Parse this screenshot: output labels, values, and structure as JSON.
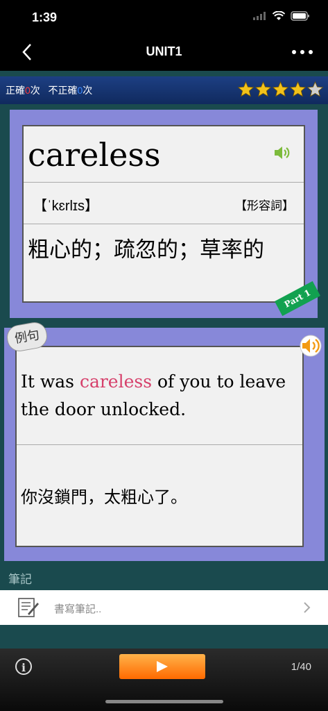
{
  "status_bar": {
    "time": "1:39"
  },
  "nav": {
    "title": "UNIT1"
  },
  "score": {
    "correct_label": "正確",
    "correct_count": "0",
    "times_suffix": "次",
    "incorrect_label": "不正確",
    "incorrect_count": "0",
    "rating": 4,
    "max_rating": 5
  },
  "word_card": {
    "word": "careless",
    "phonetic": "【ˈkɛrlɪs】",
    "part_of_speech": "【形容詞】",
    "meaning": "粗心的；疏忽的；草率的",
    "part_tag": "Part 1"
  },
  "example_card": {
    "badge": "例句",
    "sentence_before": "It was ",
    "sentence_highlight": "careless",
    "sentence_after": " of you to leave the door unlocked.",
    "translation": "你沒鎖門，太粗心了。"
  },
  "notes": {
    "label": "筆記",
    "placeholder": "書寫筆記.."
  },
  "footer": {
    "info": "i",
    "page_indicator": "1/40"
  },
  "colors": {
    "card_border": "#8788d9",
    "highlight": "#d6406b",
    "ribbon": "#12a150",
    "play_button": "#ff8a1a"
  }
}
